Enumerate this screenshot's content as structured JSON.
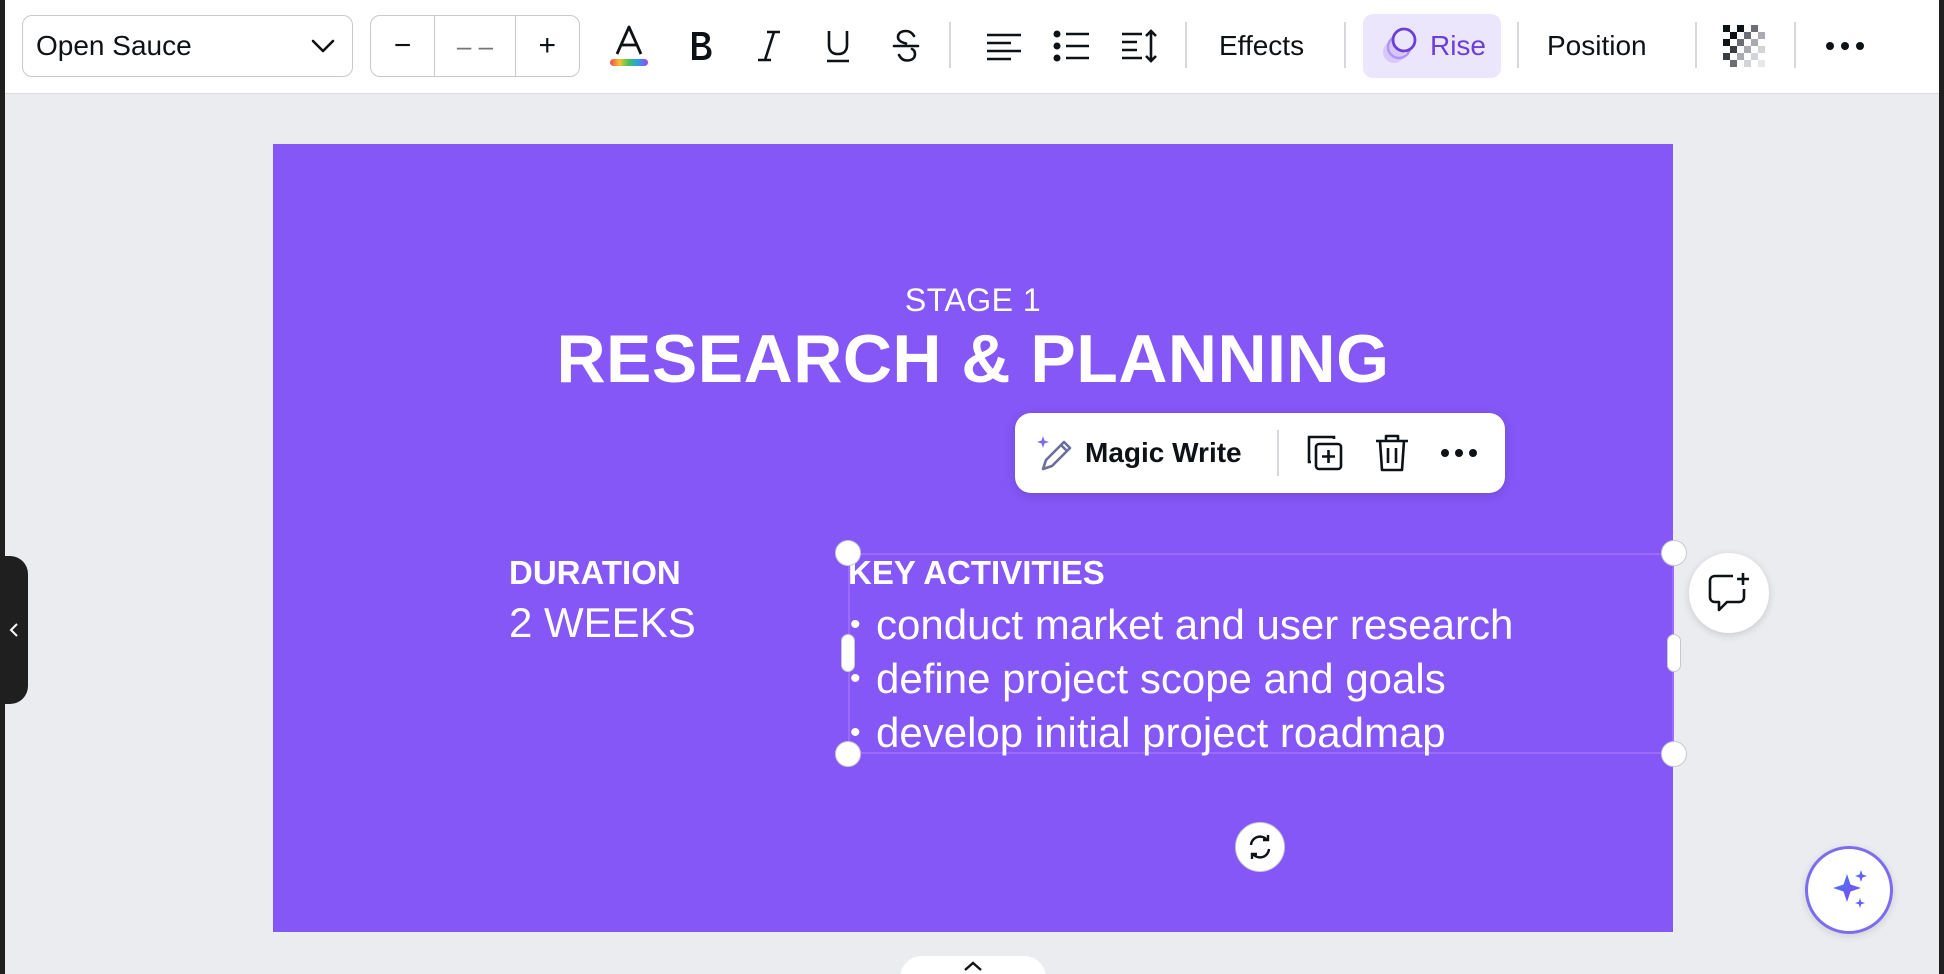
{
  "toolbar": {
    "font_family": "Open Sauce",
    "font_size_placeholder": "– –",
    "decrease_label": "−",
    "increase_label": "+",
    "effects_label": "Effects",
    "animation_label": "Rise",
    "position_label": "Position"
  },
  "context_menu": {
    "magic_write_label": "Magic Write"
  },
  "slide": {
    "stage": "STAGE 1",
    "title": "RESEARCH & PLANNING",
    "duration_label": "DURATION",
    "duration_value": "2 WEEKS",
    "activities_label": "KEY ACTIVITIES",
    "activities": [
      "conduct market and user research",
      "define project scope and goals",
      "develop initial project roadmap"
    ]
  },
  "colors": {
    "slide_background": "#8457f6",
    "selection_outline": "#9b6cff",
    "animation_button_bg": "#ece6fd",
    "accent_purple": "#6b3fd8"
  },
  "icons": [
    "chevron-down-icon",
    "text-color-icon",
    "bold-icon",
    "italic-icon",
    "underline-icon",
    "strikethrough-icon",
    "align-left-icon",
    "bullet-list-icon",
    "line-spacing-icon",
    "rise-animation-icon",
    "transparency-icon",
    "more-icon",
    "magic-write-icon",
    "duplicate-icon",
    "trash-icon",
    "rotate-icon",
    "add-comment-icon",
    "magic-sparkle-icon",
    "collapse-sidebar-icon"
  ]
}
